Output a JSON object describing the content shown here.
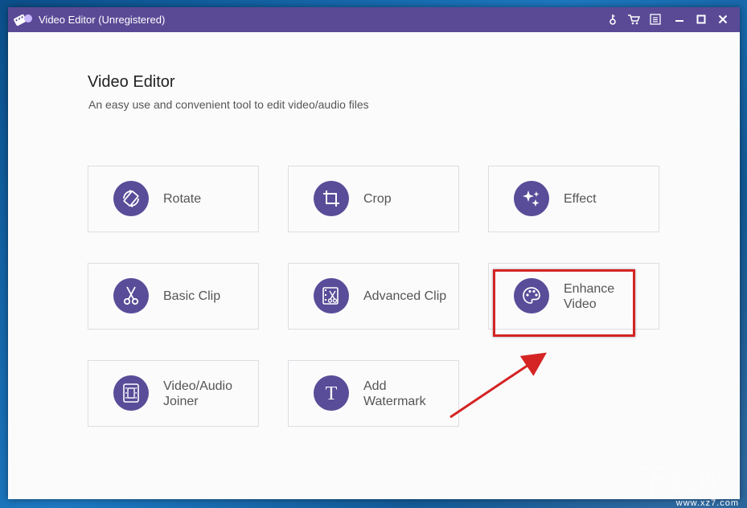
{
  "window": {
    "title": "Video Editor (Unregistered)"
  },
  "titlebar_buttons": [
    {
      "name": "key-icon"
    },
    {
      "name": "cart-icon"
    },
    {
      "name": "menu-icon"
    },
    {
      "name": "minimize-icon"
    },
    {
      "name": "maximize-icon"
    },
    {
      "name": "close-icon"
    }
  ],
  "header": {
    "title": "Video Editor",
    "subtitle": "An easy use and convenient tool to edit video/audio files"
  },
  "tools": [
    {
      "id": "rotate",
      "line1": "Rotate",
      "line2": "",
      "icon": "rotate-icon"
    },
    {
      "id": "crop",
      "line1": "Crop",
      "line2": "",
      "icon": "crop-icon"
    },
    {
      "id": "effect",
      "line1": "Effect",
      "line2": "",
      "icon": "sparkle-icon"
    },
    {
      "id": "basic-clip",
      "line1": "Basic Clip",
      "line2": "",
      "icon": "scissors-icon"
    },
    {
      "id": "advanced-clip",
      "line1": "Advanced Clip",
      "line2": "",
      "icon": "film-scissors-icon"
    },
    {
      "id": "enhance-video",
      "line1": "Enhance",
      "line2": "Video",
      "icon": "palette-icon"
    },
    {
      "id": "video-audio-joiner",
      "line1": "Video/Audio",
      "line2": "Joiner",
      "icon": "joiner-icon"
    },
    {
      "id": "add-watermark",
      "line1": "Add",
      "line2": "Watermark",
      "icon": "text-t-icon"
    }
  ],
  "colors": {
    "titlebar": "#5a4a96",
    "icon_circle": "#594c98",
    "highlight": "#d42424",
    "window_bg": "#fbfbfc"
  },
  "watermark": {
    "text": "www.xz7.com"
  }
}
